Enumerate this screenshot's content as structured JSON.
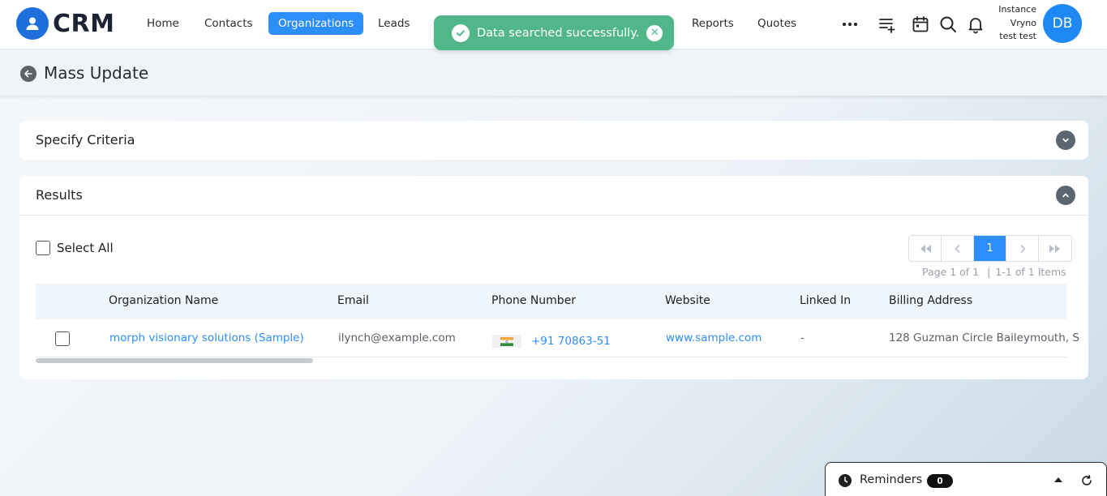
{
  "app": {
    "logo_text": "CRM"
  },
  "nav": {
    "items": [
      {
        "label": "Home",
        "active": false
      },
      {
        "label": "Contacts",
        "active": false
      },
      {
        "label": "Organizations",
        "active": true
      },
      {
        "label": "Leads",
        "active": false
      },
      {
        "label": "Reports",
        "active": false
      },
      {
        "label": "Quotes",
        "active": false
      }
    ],
    "more_icon": "more-horizontal-icon",
    "action_icons": [
      "add-list-icon",
      "calendar-icon",
      "search-icon",
      "bell-icon"
    ]
  },
  "user": {
    "line1": "Instance",
    "line2": "Vryno",
    "line3": "test test",
    "initials": "DB"
  },
  "toast": {
    "message": "Data searched successfully.",
    "color": "#52b788"
  },
  "page": {
    "title": "Mass Update"
  },
  "criteria": {
    "title": "Specify Criteria"
  },
  "results": {
    "title": "Results",
    "select_all_label": "Select All",
    "pagination": {
      "current_page": "1",
      "page_info": "Page 1 of 1",
      "items_info": "1-1 of 1 Items"
    },
    "columns": [
      "Organization Name",
      "Email",
      "Phone Number",
      "Website",
      "Linked In",
      "Billing Address"
    ],
    "rows": [
      {
        "organization_name": "morph visionary solutions (Sample)",
        "email": "ilynch@example.com",
        "phone": "+91 70863-51",
        "website": "www.sample.com",
        "linked_in": "-",
        "billing_address": "128 Guzman Circle Baileymouth, S"
      }
    ]
  },
  "reminders": {
    "label": "Reminders",
    "count": "0"
  },
  "colors": {
    "accent": "#2c8ef8",
    "logo": "#1e6fdc",
    "success": "#52b788"
  }
}
